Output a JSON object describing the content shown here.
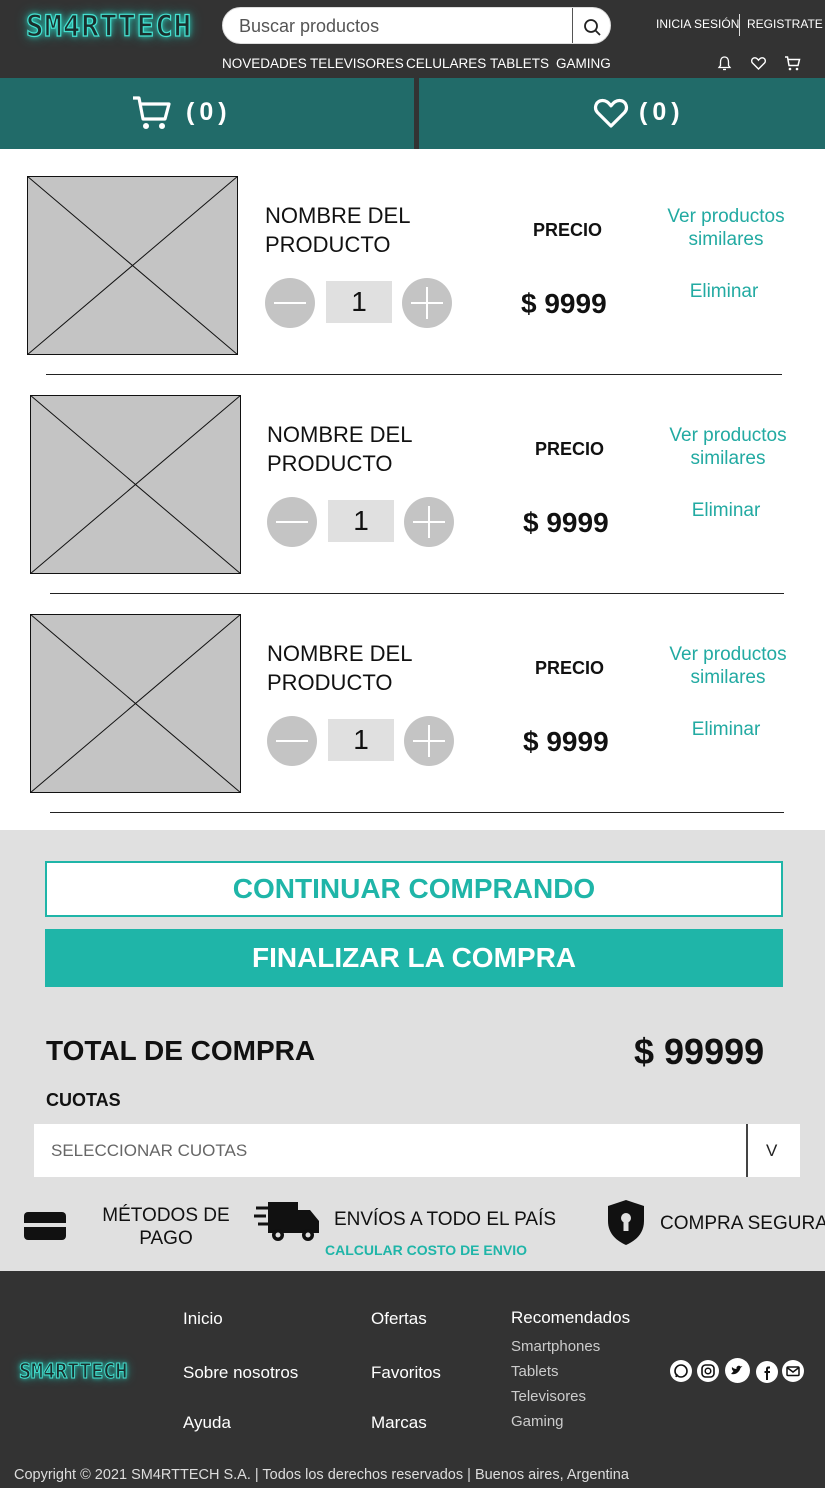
{
  "header": {
    "logo": "SM4RTTECH",
    "search_placeholder": "Buscar productos",
    "login": "INICIA SESIÓN",
    "register": "REGISTRATE",
    "nav": [
      "NOVEDADES",
      "TELEVISORES",
      "CELULARES",
      "TABLETS",
      "GAMING"
    ]
  },
  "band": {
    "cart_count": "(0)",
    "fav_count": "(0)"
  },
  "items": [
    {
      "name": "NOMBRE DEL PRODUCTO",
      "price_label": "PRECIO",
      "price": "$ 9999",
      "qty": "1",
      "similar": "Ver productos similares",
      "remove": "Eliminar"
    },
    {
      "name": "NOMBRE DEL PRODUCTO",
      "price_label": "PRECIO",
      "price": "$ 9999",
      "qty": "1",
      "similar": "Ver productos similares",
      "remove": "Eliminar"
    },
    {
      "name": "NOMBRE DEL PRODUCTO",
      "price_label": "PRECIO",
      "price": "$ 9999",
      "qty": "1",
      "similar": "Ver productos similares",
      "remove": "Eliminar"
    }
  ],
  "checkout": {
    "continue": "CONTINUAR COMPRANDO",
    "finish": "FINALIZAR LA COMPRA",
    "total_label": "TOTAL DE COMPRA",
    "total_value": "$ 99999",
    "cuotas_label": "CUOTAS",
    "cuotas_select": "SELECCIONAR CUOTAS",
    "cuotas_chevron": "V"
  },
  "features": {
    "payment": "MÉTODOS DE PAGO",
    "shipping": "ENVÍOS A TODO EL PAÍS",
    "shipping_link": "CALCULAR COSTO DE ENVIO",
    "secure": "COMPRA SEGURA"
  },
  "footer": {
    "logo": "SM4RTTECH",
    "col1": [
      "Inicio",
      "Sobre nosotros",
      "Ayuda"
    ],
    "col2": [
      "Ofertas",
      "Favoritos",
      "Marcas"
    ],
    "recommended_title": "Recomendados",
    "recommended": [
      "Smartphones",
      "Tablets",
      "Televisores",
      "Gaming"
    ],
    "copyright": "Copyright © 2021 SM4RTTECH S.A. | Todos los derechos reservados | Buenos aires, Argentina"
  },
  "colors": {
    "teal": "#1fb5a8",
    "band": "#216b69",
    "dark": "#333333"
  }
}
